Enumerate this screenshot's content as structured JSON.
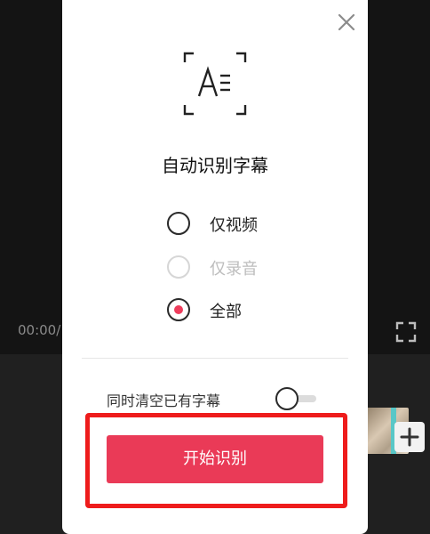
{
  "background": {
    "timecode": "00:00/",
    "fullscreen_icon": "fullscreen-icon",
    "add_clip_icon": "plus-icon"
  },
  "dialog": {
    "close_icon": "close-icon",
    "feature_icon": "auto-subtitle-icon",
    "title": "自动识别字幕",
    "options": [
      {
        "label": "仅视频",
        "selected": false,
        "disabled": false
      },
      {
        "label": "仅录音",
        "selected": false,
        "disabled": true
      },
      {
        "label": "全部",
        "selected": true,
        "disabled": false
      }
    ],
    "clear_existing_label": "同时清空已有字幕",
    "clear_existing_on": false,
    "start_button_label": "开始识别"
  },
  "colors": {
    "accent": "#ea3a57",
    "radio_dot": "#ee3d5c",
    "highlight_frame": "#ee1c1c"
  }
}
